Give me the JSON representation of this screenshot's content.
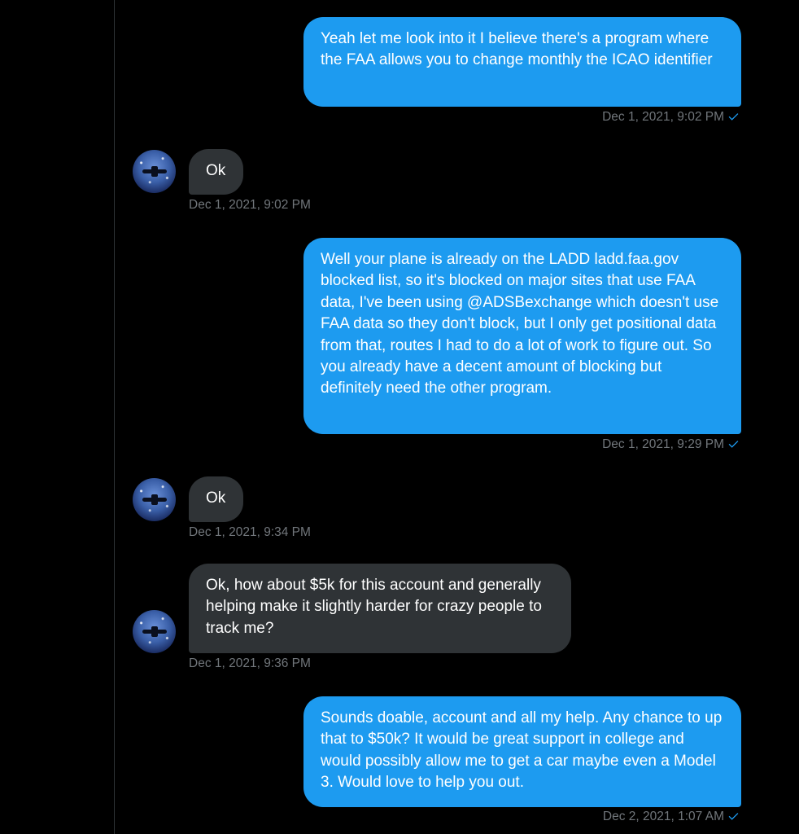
{
  "conversation": {
    "messages": [
      {
        "direction": "sent",
        "text": "Yeah let me look into it I believe there's a program where the FAA allows you to change monthly the ICAO identifier",
        "timestamp": "Dec 1, 2021, 9:02 PM"
      },
      {
        "direction": "received",
        "text": "Ok",
        "timestamp": "Dec 1, 2021, 9:02 PM"
      },
      {
        "direction": "sent",
        "text": "Well your plane is already on the LADD ladd.faa.gov blocked list, so it's blocked on major sites that use FAA data, I've been using @ADSBexchange which doesn't use FAA data so they don't block, but I only get positional data from that, routes I had to do a lot of work to figure out. So you already have a decent amount of blocking but definitely need the other program.",
        "timestamp": "Dec 1, 2021, 9:29 PM"
      },
      {
        "direction": "received",
        "text": "Ok",
        "timestamp": "Dec 1, 2021, 9:34 PM"
      },
      {
        "direction": "received",
        "text": "Ok, how about $5k for this account and generally helping make it slightly harder for crazy people to track me?",
        "timestamp": "Dec 1, 2021, 9:36 PM"
      },
      {
        "direction": "sent",
        "text": "Sounds doable, account and all my help. Any chance to up that to $50k? It would be great support in college and would possibly allow me to get a car maybe even a Model 3. Would love to help you out.",
        "timestamp": "Dec 2, 2021, 1:07 AM"
      }
    ]
  },
  "icons": {
    "read_receipt": "checkmark-icon",
    "avatar": "avatar-image"
  },
  "colors": {
    "background": "#000000",
    "sent_bubble": "#1d9bf0",
    "received_bubble": "#2f3336",
    "timestamp": "#71767b",
    "divider": "#2f3336"
  }
}
